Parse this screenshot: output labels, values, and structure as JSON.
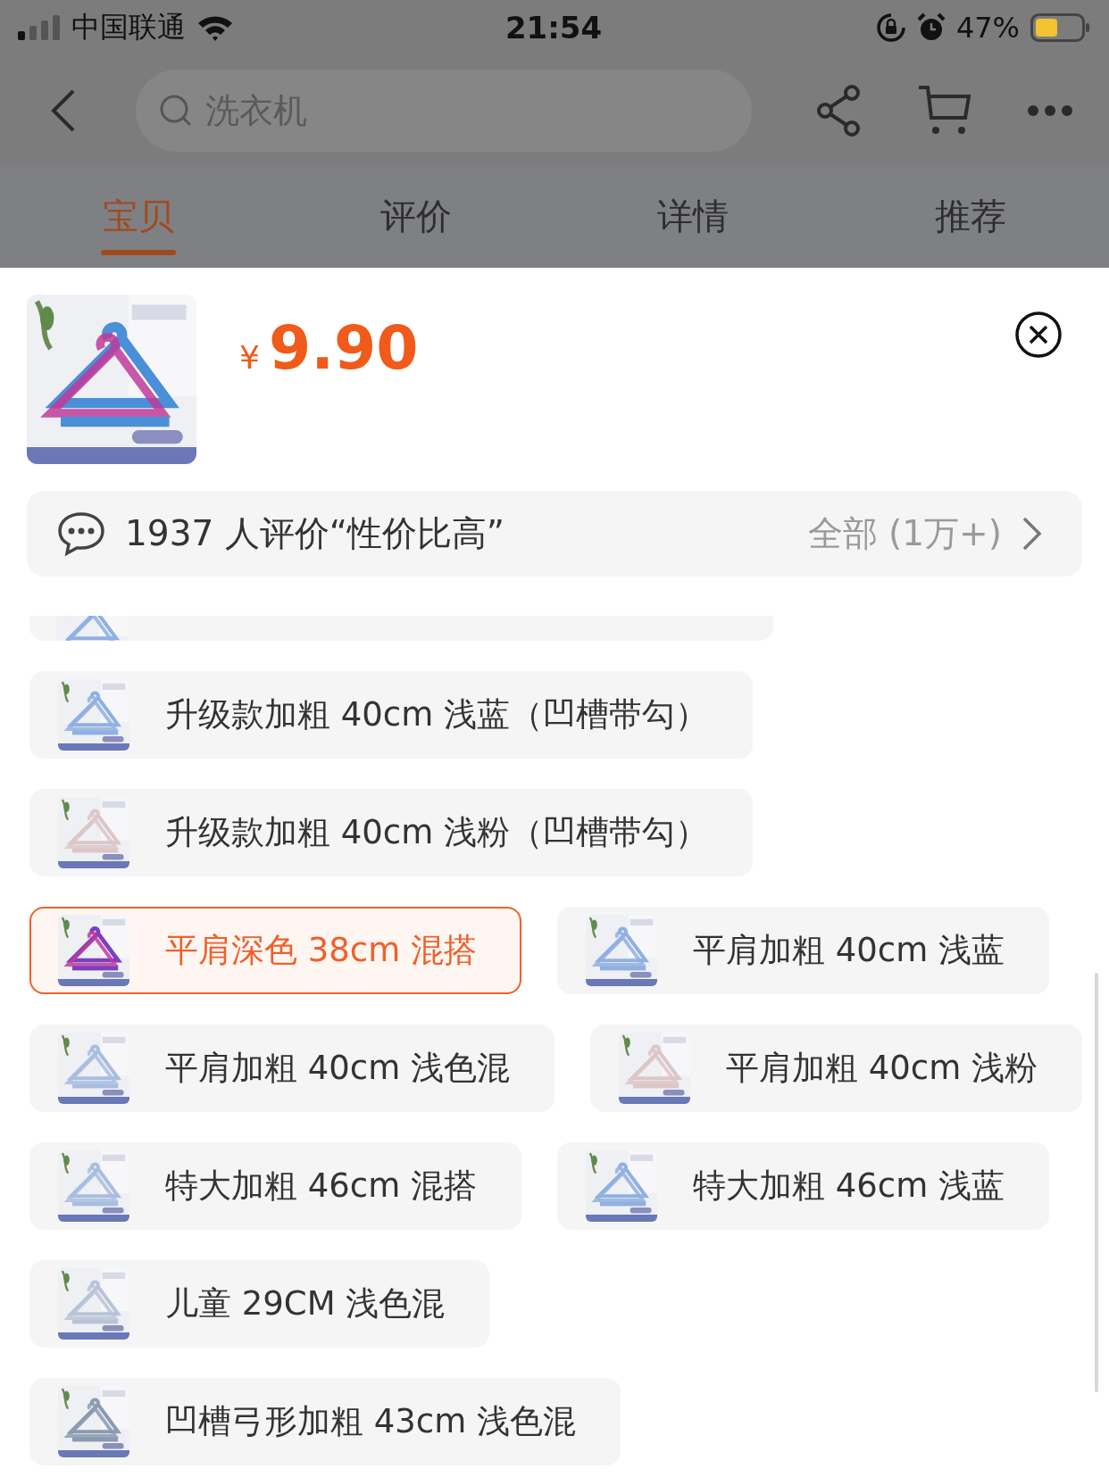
{
  "status_bar": {
    "carrier": "中国联通",
    "time": "21:54",
    "battery": "47%"
  },
  "search": {
    "placeholder": "洗衣机"
  },
  "tabs": [
    {
      "label": "宝贝",
      "selected": true
    },
    {
      "label": "评价",
      "selected": false
    },
    {
      "label": "详情",
      "selected": false
    },
    {
      "label": "推荐",
      "selected": false
    }
  ],
  "product": {
    "currency": "¥",
    "price": "9.90"
  },
  "reviews": {
    "summary": "1937 人评价“性价比高”",
    "all": "全部 (1万+)"
  },
  "option_rows": [
    [
      {
        "kind": "cut"
      }
    ],
    [
      {
        "kind": "chip",
        "label": "升级款加粗 40cm 浅蓝（凹槽带勾）",
        "selected": false
      }
    ],
    [
      {
        "kind": "chip",
        "label": "升级款加粗 40cm 浅粉（凹槽带勾）",
        "selected": false
      }
    ],
    [
      {
        "kind": "chip",
        "label": "平肩深色 38cm 混搭",
        "selected": true
      },
      {
        "kind": "chip",
        "label": "平肩加粗 40cm 浅蓝",
        "selected": false
      }
    ],
    [
      {
        "kind": "chip",
        "label": "平肩加粗 40cm 浅色混",
        "selected": false
      },
      {
        "kind": "chip",
        "label": "平肩加粗 40cm 浅粉",
        "selected": false
      }
    ],
    [
      {
        "kind": "chip",
        "label": "特大加粗 46cm 混搭",
        "selected": false
      },
      {
        "kind": "chip",
        "label": "特大加粗 46cm 浅蓝",
        "selected": false
      }
    ],
    [
      {
        "kind": "chip",
        "label": "儿童 29CM 浅色混",
        "selected": false
      }
    ],
    [
      {
        "kind": "chip",
        "label": "凹槽弓形加粗 43cm 浅色混",
        "selected": false
      }
    ]
  ]
}
